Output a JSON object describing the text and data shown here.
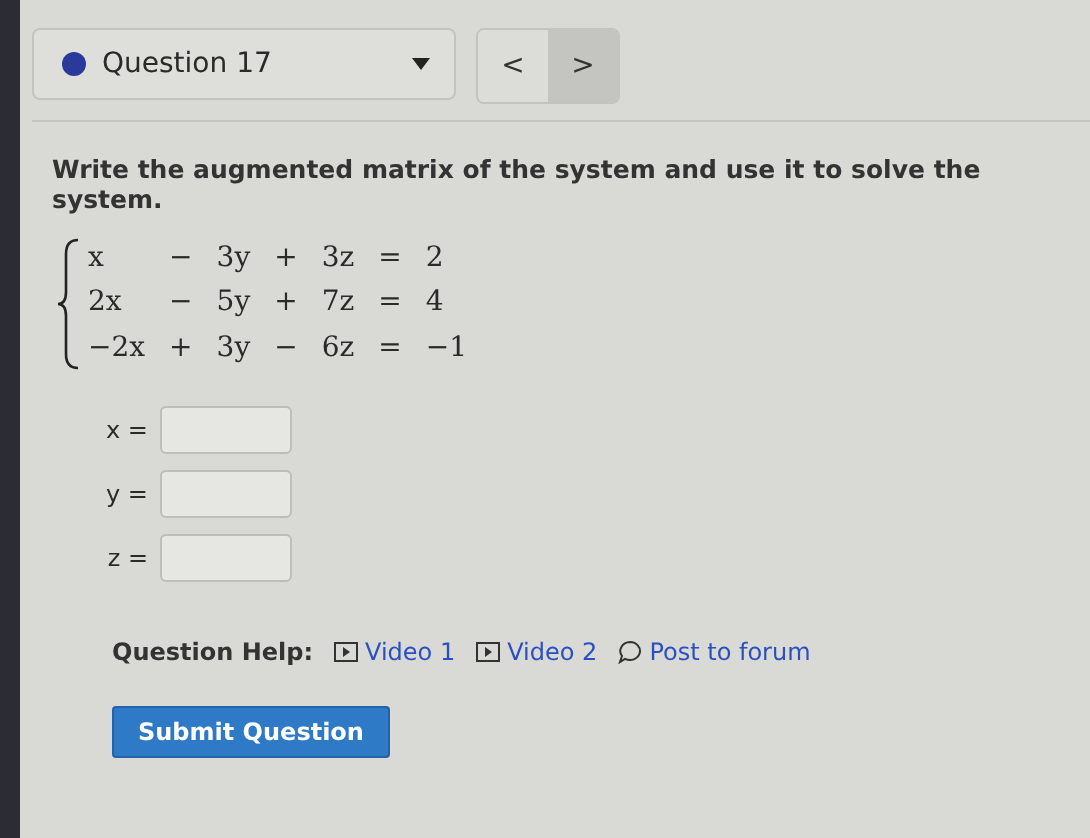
{
  "question": {
    "title": "Question 17"
  },
  "nav": [
    {
      "label": "<",
      "selected": false
    },
    {
      "label": ">",
      "selected": true
    }
  ],
  "prompt": "Write the augmented matrix of the system and use it to solve the system.",
  "system": [
    [
      "x",
      "−",
      "3y",
      "+",
      "3z",
      "=",
      "2"
    ],
    [
      "2x",
      "−",
      "5y",
      "+",
      "7z",
      "=",
      "4"
    ],
    [
      "−2x",
      "+",
      "3y",
      "−",
      "6z",
      "=",
      "−1"
    ]
  ],
  "answers": [
    {
      "label": "x ="
    },
    {
      "label": "y ="
    },
    {
      "label": "z ="
    }
  ],
  "help": {
    "label": "Question Help:",
    "links": [
      {
        "kind": "video",
        "label": "Video 1"
      },
      {
        "kind": "video",
        "label": "Video 2"
      },
      {
        "kind": "forum",
        "label": "Post to forum"
      }
    ]
  },
  "submit": "Submit Question"
}
